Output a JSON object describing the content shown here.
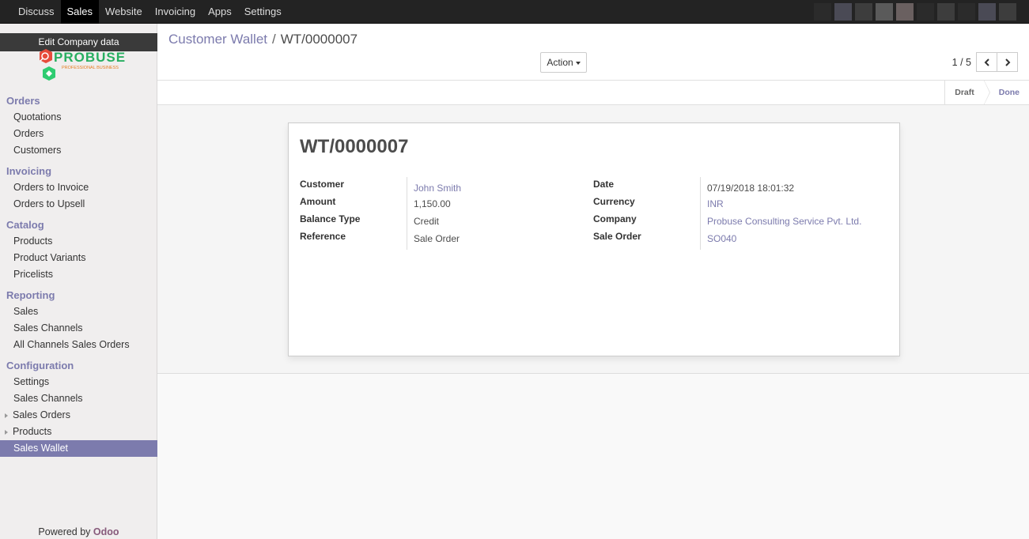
{
  "topnav": {
    "items": [
      "Discuss",
      "Sales",
      "Website",
      "Invoicing",
      "Apps",
      "Settings"
    ],
    "active": "Sales"
  },
  "sidebar": {
    "edit_company": "Edit Company data",
    "logo_text": "PROBUSE",
    "logo_subtext": "PROFESSIONAL BUSINESS",
    "sections": [
      {
        "title": "Orders",
        "items": [
          "Quotations",
          "Orders",
          "Customers"
        ]
      },
      {
        "title": "Invoicing",
        "items": [
          "Orders to Invoice",
          "Orders to Upsell"
        ]
      },
      {
        "title": "Catalog",
        "items": [
          "Products",
          "Product Variants",
          "Pricelists"
        ]
      },
      {
        "title": "Reporting",
        "items": [
          "Sales",
          "Sales Channels",
          "All Channels Sales Orders"
        ]
      },
      {
        "title": "Configuration",
        "items": [
          "Settings",
          "Sales Channels",
          "Sales Orders",
          "Products",
          "Sales Wallet"
        ]
      }
    ],
    "active_item": "Sales Wallet",
    "powered_by": "Powered by",
    "powered_brand": "Odoo"
  },
  "breadcrumb": {
    "parent": "Customer Wallet",
    "separator": "/",
    "current": "WT/0000007"
  },
  "toolbar": {
    "action_label": "Action",
    "pager_value": "1 / 5"
  },
  "statusbar": {
    "draft": "Draft",
    "done": "Done"
  },
  "form": {
    "title": "WT/0000007",
    "left": [
      {
        "label": "Customer",
        "value": "John Smith",
        "link": true
      },
      {
        "label": "Amount",
        "value": "1,150.00",
        "link": false
      },
      {
        "label": "Balance Type",
        "value": "Credit",
        "link": false
      },
      {
        "label": "Reference",
        "value": "Sale Order",
        "link": false
      }
    ],
    "right": [
      {
        "label": "Date",
        "value": "07/19/2018 18:01:32",
        "link": false
      },
      {
        "label": "Currency",
        "value": "INR",
        "link": true
      },
      {
        "label": "Company",
        "value": "Probuse Consulting Service Pvt. Ltd.",
        "link": true
      },
      {
        "label": "Sale Order",
        "value": "SO040",
        "link": true
      }
    ]
  },
  "colors": {
    "accent": "#7c7bad",
    "topbar": "#232323",
    "odoo": "#875a7b"
  }
}
